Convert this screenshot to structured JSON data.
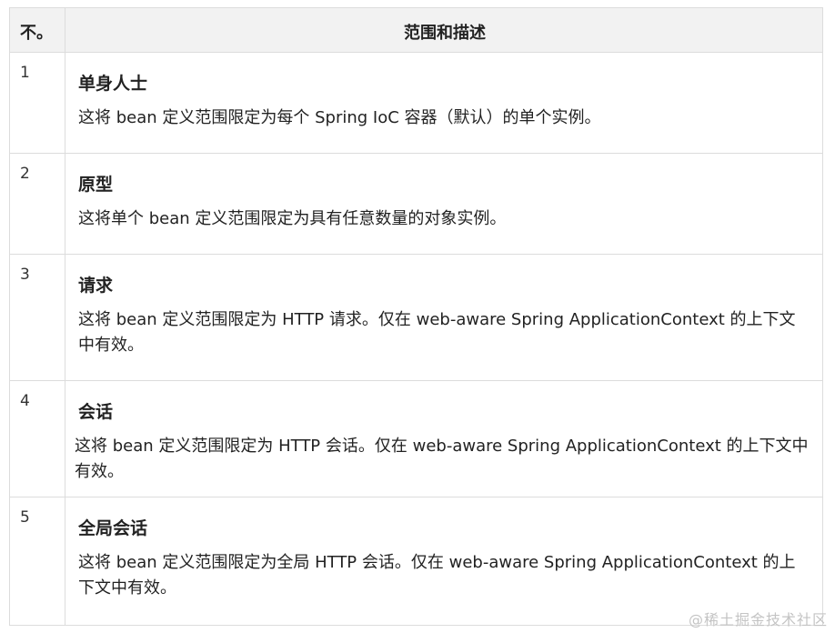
{
  "table": {
    "header": {
      "num": "不。",
      "desc": "范围和描述"
    },
    "rows": [
      {
        "num": "1",
        "title": "单身人士",
        "desc": "这将 bean 定义范围限定为每个 Spring IoC 容器（默认）的单个实例。"
      },
      {
        "num": "2",
        "title": "原型",
        "desc": "这将单个 bean 定义范围限定为具有任意数量的对象实例。"
      },
      {
        "num": "3",
        "title": "请求",
        "desc": "这将 bean 定义范围限定为 HTTP 请求。仅在 web-aware Spring ApplicationContext 的上下文中有效。"
      },
      {
        "num": "4",
        "title": "会话",
        "desc": "这将 bean 定义范围限定为 HTTP 会话。仅在 web-aware Spring ApplicationContext 的上下文中有效。"
      },
      {
        "num": "5",
        "title": "全局会话",
        "desc": "这将 bean 定义范围限定为全局 HTTP 会话。仅在 web-aware Spring ApplicationContext 的上下文中有效。"
      }
    ]
  },
  "watermark": "@稀土掘金技术社区"
}
